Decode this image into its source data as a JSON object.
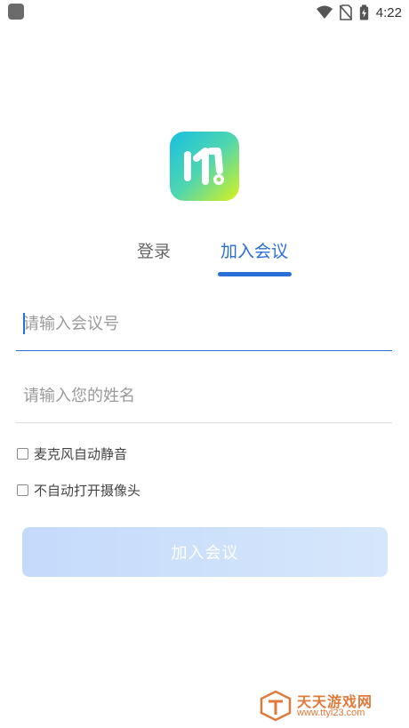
{
  "status_bar": {
    "time": "4:22"
  },
  "tabs": {
    "login": "登录",
    "join": "加入会议"
  },
  "form": {
    "meeting_id_placeholder": "请输入会议号",
    "name_placeholder": "请输入您的姓名"
  },
  "options": {
    "mute_mic": "麦克风自动静音",
    "camera_off": "不自动打开摄像头"
  },
  "actions": {
    "join_button": "加入会议"
  },
  "watermark": {
    "title": "天天游戏网",
    "url": "www.ttyl23.com"
  },
  "colors": {
    "accent": "#2a6fd8",
    "button_bg": "#cfe1fb",
    "watermark": "#e07a3a"
  }
}
